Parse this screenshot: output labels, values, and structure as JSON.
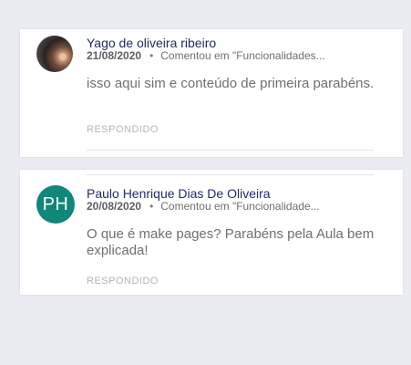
{
  "comments": [
    {
      "author": "Yago de oliveira ribeiro",
      "date": "21/08/2020",
      "separator": "•",
      "activity": "Comentou em \"Funcionalidades...",
      "text": "isso aqui sim e conteúdo de primeira parabéns.",
      "status": "RESPONDIDO",
      "avatar": {
        "type": "photo"
      }
    },
    {
      "author": "Paulo Henrique Dias De Oliveira",
      "date": "20/08/2020",
      "separator": "•",
      "activity": "Comentou em \"Funcionalidade...",
      "text": "O que é make pages? Parabéns pela Aula bem explicada!",
      "status": "RESPONDIDO",
      "avatar": {
        "type": "initials",
        "initials": "PH",
        "color": "#11867b"
      }
    }
  ],
  "colors": {
    "page_background": "#ebebf3",
    "card_background": "#ffffff",
    "author_text": "#1f2d64",
    "body_text": "#6f6f74",
    "status_text": "#b5b5ba"
  }
}
